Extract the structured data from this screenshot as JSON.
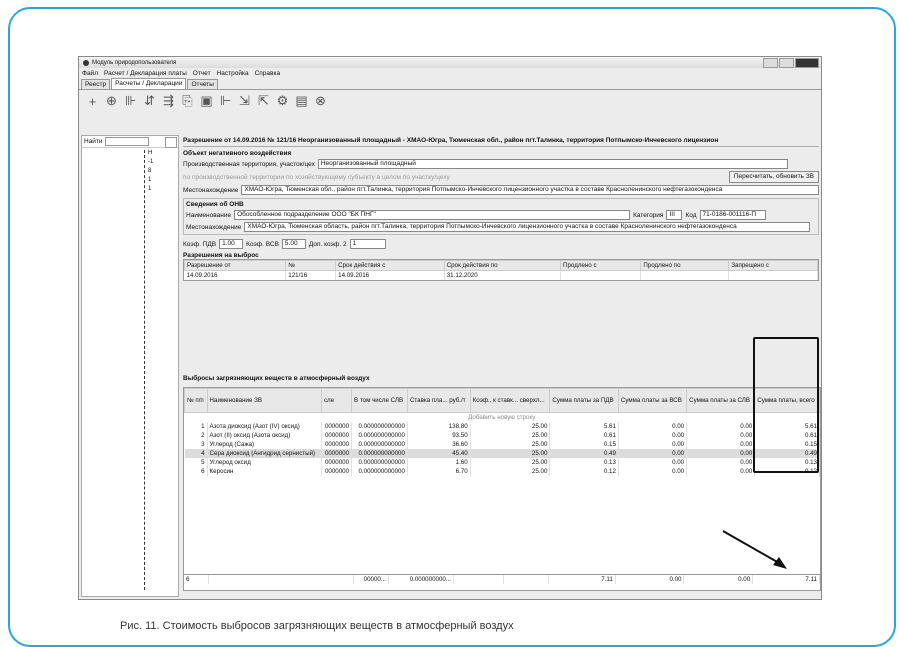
{
  "window": {
    "title": "Модуль природопользователя"
  },
  "menu": [
    "Файл",
    "Расчет / Декларация платы",
    "Отчет",
    "Настройка",
    "Справка"
  ],
  "tabs": [
    "Реестр",
    "Расчеты / Декларации",
    "Отчеты"
  ],
  "left": {
    "find_label": "Найти",
    "tree": [
      "Н",
      "-1",
      "8",
      "1",
      "1"
    ]
  },
  "permit_title": "Разрешение от 14.09.2016 № 121/16 Неорганизованный площадный - ХМАО-Югра, Тюменская обл., район пгт.Талинка, территория Потпымско-Инчевского лицензион",
  "object": {
    "section": "Объект негативного воздействия",
    "territory_label": "Производственная территория, участок/цех",
    "territory_value": "Неорганизованный площадный",
    "radio_1": "по производственной территории",
    "radio_2": "по хозяйствующему субъекту в целом",
    "radio_3": "по участку/цеху",
    "recalc_button": "Пересчитать, обновить ЗВ",
    "location_label": "Местонахождение",
    "location_value": "ХМАО-Югра, Тюменская обл., район пгт.Талинка, территория Потпымско-Инчевского лицензионного участка в составе Красноленинского нефтегазоконденса"
  },
  "onv": {
    "section": "Сведения об ОНВ",
    "name_label": "Наименование",
    "name_value": "Обособленное подразделение ООО \"БК ПНГ\"",
    "category_label": "Категория",
    "category_value": "III",
    "code_label": "Код",
    "code_value": "71-0186-001116-П",
    "location_label": "Местонахождение",
    "location_value": "ХМАО-Югра, Тюменская область, район пгт.Талинка, территория Потпымско-Инчевского лицензионного участка в составе Красноленинского нефтегазоконденса"
  },
  "coef": {
    "pdv_label": "Коэф. ПДВ",
    "pdv": "1.00",
    "vsv_label": "Коэф. ВСВ",
    "vsv": "5.00",
    "dop_label": "Доп. коэф. 2",
    "dop": "1"
  },
  "permits": {
    "section": "Разрешения на выброс",
    "headers": [
      "Разрешение от",
      "№",
      "Срок действия с",
      "Срок действия по",
      "Продлено с",
      "Продлено по",
      "Запрещено с"
    ],
    "row": [
      "14.09.2016",
      "121/16",
      "14.09.2016",
      "31.12.2020",
      "",
      "",
      ""
    ]
  },
  "emissions": {
    "section": "Выбросы загрязняющих веществ в атмосферный воздух",
    "headers": [
      "№ п/п",
      "Наименование ЗВ",
      "сле",
      "В том числе СЛВ",
      "Ставка пла... руб./т",
      "Коэф., к ставк... сверхл...",
      "Сумма платы за ПДВ",
      "Сумма платы за ВСВ",
      "Сумма платы за СЛВ",
      "Сумма платы, всего"
    ],
    "add_row": "Добавить новую строку",
    "rows": [
      {
        "n": "1",
        "name": "Азота диоксид (Азот (IV) оксид)",
        "sle": "0000000",
        "slv": "0.000000000000",
        "rate": "138.80",
        "coef": "25.00",
        "pdv": "5.61",
        "vsv": "0.00",
        "slvsum": "0.00",
        "total": "5.61"
      },
      {
        "n": "2",
        "name": "Азот (II) оксид (Азота оксид)",
        "sle": "0000000",
        "slv": "0.000000000000",
        "rate": "93.50",
        "coef": "25.00",
        "pdv": "0.61",
        "vsv": "0.00",
        "slvsum": "0.00",
        "total": "0.61"
      },
      {
        "n": "3",
        "name": "Углерод (Сажа)",
        "sle": "0000000",
        "slv": "0.000000000000",
        "rate": "36.60",
        "coef": "25.00",
        "pdv": "0.15",
        "vsv": "0.00",
        "slvsum": "0.00",
        "total": "0.15"
      },
      {
        "n": "4",
        "name": "Сера диоксид (Ангидрид сернистый)",
        "sle": "0000000",
        "slv": "0.000000000000",
        "rate": "45.40",
        "coef": "25.00",
        "pdv": "0.49",
        "vsv": "0.00",
        "slvsum": "0.00",
        "total": "0.49"
      },
      {
        "n": "5",
        "name": "Углерод оксид",
        "sle": "0000000",
        "slv": "0.000000000000",
        "rate": "1.60",
        "coef": "25.00",
        "pdv": "0.13",
        "vsv": "0.00",
        "slvsum": "0.00",
        "total": "0.13"
      },
      {
        "n": "6",
        "name": "Керосин",
        "sle": "0000000",
        "slv": "0.000000000000",
        "rate": "6.70",
        "coef": "25.00",
        "pdv": "0.12",
        "vsv": "0.00",
        "slvsum": "0.00",
        "total": "0.12"
      }
    ],
    "totals": {
      "n": "6",
      "sle": "00000...",
      "slv": "0.000000000...",
      "pdv": "7.11",
      "vsv": "0.00",
      "slvsum": "0.00",
      "total": "7.11"
    }
  },
  "caption": "Рис. 11. Стоимость выбросов загрязняющих веществ в атмосферный воздух"
}
